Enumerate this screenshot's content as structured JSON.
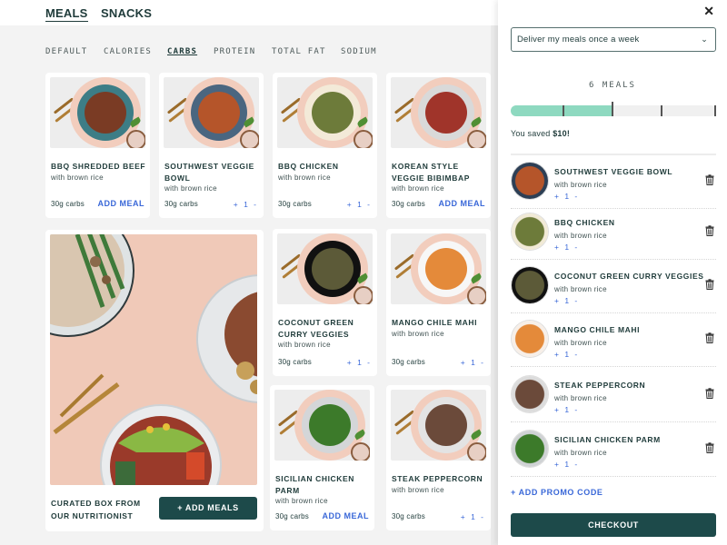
{
  "nav": {
    "tabs": [
      {
        "label": "MEALS",
        "active": true
      },
      {
        "label": "SNACKS",
        "active": false
      }
    ]
  },
  "sort": {
    "options": [
      {
        "label": "DEFAULT",
        "active": false
      },
      {
        "label": "CALORIES",
        "active": false
      },
      {
        "label": "CARBS",
        "active": true
      },
      {
        "label": "PROTEIN",
        "active": false
      },
      {
        "label": "TOTAL FAT",
        "active": false
      },
      {
        "label": "SODIUM",
        "active": false
      }
    ]
  },
  "meals": [
    {
      "name": "BBQ SHREDDED BEEF",
      "sub": "with brown rice",
      "carbs": "30g carbs",
      "action": "ADD MEAL",
      "in_cart": false,
      "plate": "#3d7d86",
      "food": "#7a3b24"
    },
    {
      "name": "SOUTHWEST VEGGIE BOWL",
      "sub": "with brown rice",
      "carbs": "30g carbs",
      "stepper": "+ 1 -",
      "in_cart": true,
      "plate": "#4a6680",
      "food": "#b5552a"
    },
    {
      "name": "BBQ CHICKEN",
      "sub": "with brown rice",
      "carbs": "30g carbs",
      "stepper": "+ 1 -",
      "in_cart": true,
      "plate": "#f3ead8",
      "food": "#6d7b3a"
    },
    {
      "name": "KOREAN STYLE VEGGIE BIBIMBAP",
      "sub": "with brown rice",
      "carbs": "30g carbs",
      "action": "ADD MEAL",
      "in_cart": false,
      "plate": "#d9d9d9",
      "food": "#a0342a"
    },
    {
      "name": "COCONUT GREEN CURRY VEGGIES",
      "sub": "with brown rice",
      "carbs": "30g carbs",
      "stepper": "+ 1 -",
      "in_cart": true,
      "plate": "#111111",
      "food": "#5c5a38"
    },
    {
      "name": "MANGO CHILE MAHI",
      "sub": "with brown rice",
      "carbs": "30g carbs",
      "stepper": "+ 1 -",
      "in_cart": true,
      "plate": "#f7f7f7",
      "food": "#e48a3a"
    },
    {
      "name": "SICILIAN CHICKEN PARM",
      "sub": "with brown rice",
      "carbs": "30g carbs",
      "action": "ADD MEAL",
      "in_cart": false,
      "plate": "#d4d6d8",
      "food": "#3c7a2a"
    },
    {
      "name": "STEAK PEPPERCORN",
      "sub": "with brown rice",
      "carbs": "30g carbs",
      "stepper": "+ 1 -",
      "in_cart": true,
      "plate": "#e3e3e3",
      "food": "#6b4a3a"
    }
  ],
  "curated": {
    "label": "CURATED BOX FROM OUR NUTRITIONIST",
    "button": "+ ADD MEALS"
  },
  "cart": {
    "delivery_select": "Deliver my meals once a week",
    "meals_count": "6 MEALS",
    "progress": {
      "filled_fraction": 0.5,
      "current_meals": 6
    },
    "saved_prefix": "You saved ",
    "saved_amount": "$10!",
    "items": [
      {
        "name": "SOUTHWEST VEGGIE BOWL",
        "sub": "with brown rice",
        "stepper": "+ 1 -",
        "plate": "#2d3f55",
        "food": "#b5552a"
      },
      {
        "name": "BBQ CHICKEN",
        "sub": "with brown rice",
        "stepper": "+ 1 -",
        "plate": "#f1ead6",
        "food": "#6d7b3a"
      },
      {
        "name": "COCONUT GREEN CURRY VEGGIES",
        "sub": "with brown rice",
        "stepper": "+ 1 -",
        "plate": "#111111",
        "food": "#5c5a38"
      },
      {
        "name": "MANGO CHILE MAHI",
        "sub": "with brown rice",
        "stepper": "+ 1 -",
        "plate": "#f7efe8",
        "food": "#e48a3a"
      },
      {
        "name": "STEAK PEPPERCORN",
        "sub": "with brown rice",
        "stepper": "+ 1 -",
        "plate": "#dcdcdc",
        "food": "#6b4a3a"
      },
      {
        "name": "SICILIAN CHICKEN PARM",
        "sub": "with brown rice",
        "stepper": "+ 1 -",
        "plate": "#cfd2d4",
        "food": "#3c7a2a"
      }
    ],
    "promo": "+ ADD PROMO CODE",
    "checkout": "CHECKOUT"
  },
  "colors": {
    "brand_dark": "#1d4a4a",
    "link_blue": "#3a68d8",
    "progress_fill": "#8ed9c0",
    "hero_pink": "#f0c9b8"
  }
}
